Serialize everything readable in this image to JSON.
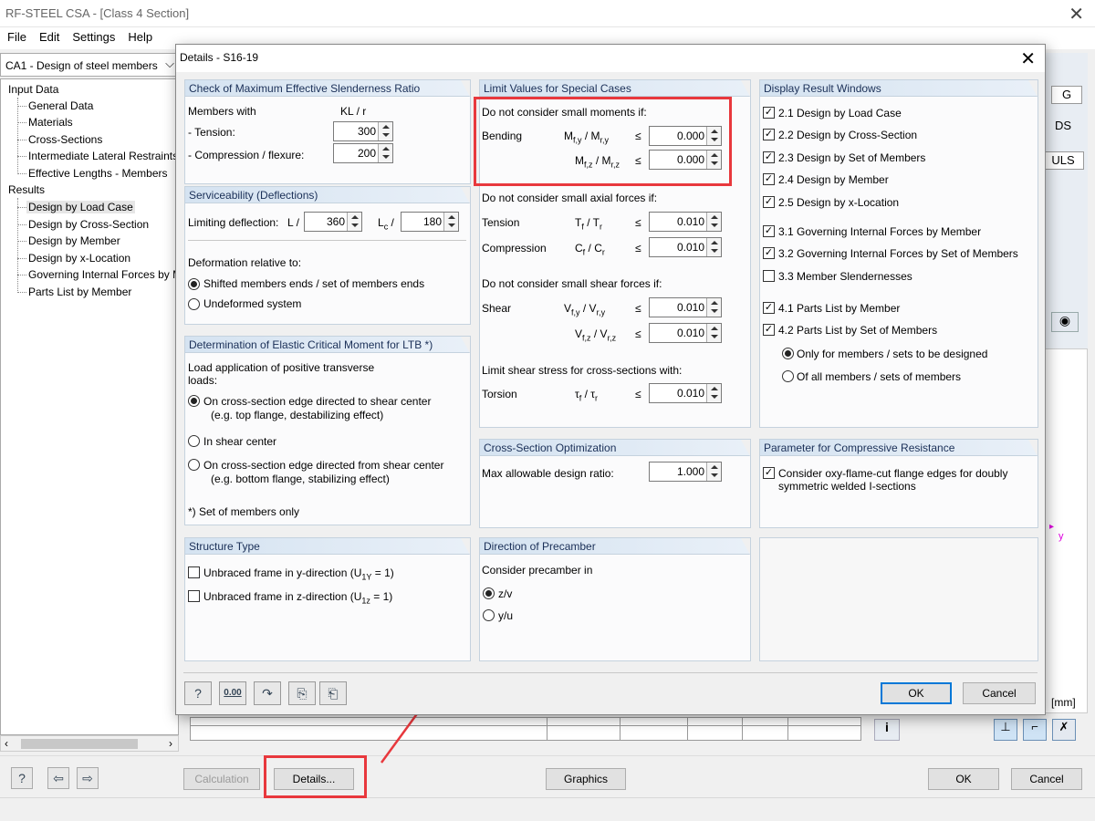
{
  "app": {
    "title": "RF-STEEL CSA - [Class 4 Section]",
    "menu": [
      "File",
      "Edit",
      "Settings",
      "Help"
    ],
    "case_select": "CA1 - Design of steel members"
  },
  "tree": {
    "input_header": "Input Data",
    "input_items": [
      "General Data",
      "Materials",
      "Cross-Sections",
      "Intermediate Lateral Restraints",
      "Effective Lengths - Members"
    ],
    "results_header": "Results",
    "result_items": [
      "Design by Load Case",
      "Design by Cross-Section",
      "Design by Member",
      "Design by x-Location",
      "Governing Internal Forces by Member",
      "Parts List by Member"
    ],
    "selected": "Design by Load Case"
  },
  "right_panel": {
    "tab_g": "G",
    "tab_ds": "DS",
    "tab_uls": "ULS",
    "axis_y": "y",
    "unit_label": "[mm]"
  },
  "bottom": {
    "calculation": "Calculation",
    "details": "Details...",
    "graphics": "Graphics",
    "ok": "OK",
    "cancel": "Cancel"
  },
  "dialog": {
    "title": "Details - S16-19",
    "slender": {
      "title": "Check of Maximum Effective Slenderness Ratio",
      "members_with": "Members with",
      "kl_r": "KL / r",
      "tension_label": "- Tension:",
      "tension_value": "300",
      "compression_label": "- Compression / flexure:",
      "compression_value": "200"
    },
    "service": {
      "title": "Serviceability (Deflections)",
      "limiting": "Limiting deflection:",
      "l_sym": "L /",
      "l_value": "360",
      "lc_sym": "L",
      "lc_sub": "c",
      "lc_slash": "/",
      "lc_value": "180",
      "deform": "Deformation relative to:",
      "opt1": "Shifted members ends / set of members ends",
      "opt2": "Undeformed system"
    },
    "ltb": {
      "title": "Determination of Elastic Critical Moment for LTB *)",
      "load1": "Load application of positive transverse",
      "load2": "loads:",
      "opt1a": "On cross-section edge directed to shear center",
      "opt1b": "(e.g. top flange, destabilizing effect)",
      "opt2": "In shear center",
      "opt3a": "On cross-section edge directed from shear center",
      "opt3b": "(e.g. bottom flange, stabilizing effect)",
      "note": "*) Set of members only"
    },
    "structure": {
      "title": "Structure Type",
      "y_pre": "Unbraced frame in y-direction (U",
      "y_sub": "1Y",
      "y_post": " = 1)",
      "z_pre": "Unbraced frame in z-direction (U",
      "z_sub": "1z",
      "z_post": " = 1)"
    },
    "limits": {
      "title": "Limit Values for Special Cases",
      "moments_head": "Do not consider small moments if:",
      "bending": "Bending",
      "my_sym": "M",
      "my_sub1": "f,y",
      "my_sub2": "r,y",
      "mz_sub1": "f,z",
      "mz_sub2": "r,z",
      "my_value": "0.000",
      "mz_value": "0.000",
      "axial_head": "Do not consider small axial forces if:",
      "tension": "Tension",
      "t_sym": "T",
      "t_sub1": "f",
      "t_sub2": "r",
      "tension_value": "0.010",
      "compression": "Compression",
      "c_sym": "C",
      "c_sub1": "f",
      "c_sub2": "r",
      "compression_value": "0.010",
      "shear_head": "Do not consider small shear forces if:",
      "shear": "Shear",
      "v_sym": "V",
      "vy_sub1": "f,y",
      "vy_sub2": "r,y",
      "vz_sub1": "f,z",
      "vz_sub2": "r,z",
      "vy_value": "0.010",
      "vz_value": "0.010",
      "torsion_head": "Limit shear stress for cross-sections with:",
      "torsion": "Torsion",
      "tau_sym": "τ",
      "tau_sub1": "f",
      "tau_sub2": "r",
      "torsion_value": "0.010",
      "leq": "≤",
      "slash": " / "
    },
    "optimization": {
      "title": "Cross-Section Optimization",
      "label": "Max allowable design ratio:",
      "value": "1.000"
    },
    "precamber": {
      "title": "Direction of Precamber",
      "label": "Consider precamber in",
      "opt1": "z/v",
      "opt2": "y/u"
    },
    "display": {
      "title": "Display Result Windows",
      "items": [
        {
          "label": "2.1 Design by Load Case",
          "checked": true
        },
        {
          "label": "2.2 Design by Cross-Section",
          "checked": true
        },
        {
          "label": "2.3 Design by Set of Members",
          "checked": true
        },
        {
          "label": "2.4 Design by Member",
          "checked": true
        },
        {
          "label": "2.5 Design by x-Location",
          "checked": true
        },
        {
          "label": "3.1 Governing Internal Forces by Member",
          "checked": true
        },
        {
          "label": "3.2 Governing Internal Forces by Set of Members",
          "checked": true
        },
        {
          "label": "3.3 Member Slendernesses",
          "checked": false
        },
        {
          "label": "4.1 Parts List by Member",
          "checked": true
        },
        {
          "label": "4.2 Parts List by Set of Members",
          "checked": true
        }
      ],
      "sub_opt1": "Only for members / sets to be designed",
      "sub_opt2": "Of all members / sets of members"
    },
    "compressive": {
      "title": "Parameter for Compressive Resistance",
      "line1": "Consider oxy-flame-cut flange edges for doubly",
      "line2": "symmetric welded I-sections"
    },
    "footer": {
      "ok": "OK",
      "cancel": "Cancel",
      "zero_icon": "0.00"
    }
  },
  "icons": [
    "help-icon",
    "decimal-places-icon",
    "undo-icon",
    "export-icon",
    "import-icon",
    "eye-icon",
    "info-icon",
    "close-icon"
  ],
  "colors": {
    "highlight": "#e8383d",
    "group_header": "#d5e3f1",
    "axis": "#e000e0"
  }
}
